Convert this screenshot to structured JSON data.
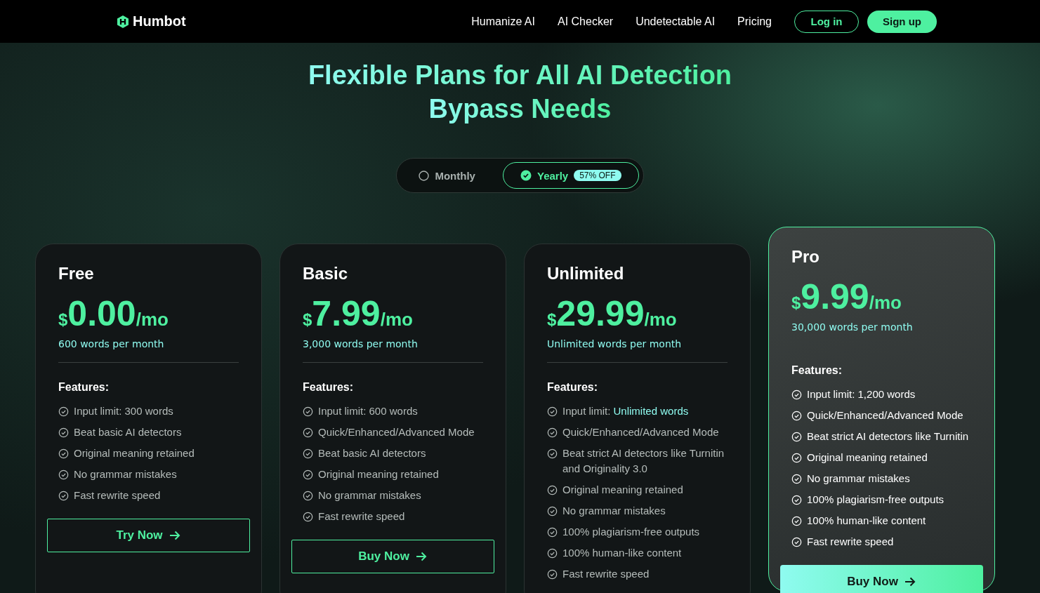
{
  "nav": {
    "brand": "Humbot",
    "links": [
      {
        "label": "Humanize AI"
      },
      {
        "label": "AI Checker"
      },
      {
        "label": "Undetectable AI"
      },
      {
        "label": "Pricing"
      }
    ],
    "login": "Log in",
    "signup": "Sign up"
  },
  "headline": [
    "Flexible Plans for All AI Detection",
    "Bypass Needs"
  ],
  "billing": [
    {
      "label": "Monthly",
      "selected": false
    },
    {
      "label": "Yearly",
      "selected": true,
      "badge": "57% OFF"
    }
  ],
  "plans": [
    {
      "name": "Free",
      "currency": "$",
      "price": "0.00",
      "period": "/mo",
      "words": "600 words per month",
      "featured": false,
      "features_title": "Features:",
      "features": [
        {
          "text": "Input limit: 300 words"
        },
        {
          "text": "Beat basic AI detectors"
        },
        {
          "text": "Original meaning retained"
        },
        {
          "text": "No grammar mistakes"
        },
        {
          "text": "Fast rewrite speed"
        }
      ],
      "button": "Try Now"
    },
    {
      "name": "Basic",
      "currency": "$",
      "price": "7.99",
      "period": "/mo",
      "words": "3,000 words per month",
      "featured": false,
      "features_title": "Features:",
      "features": [
        {
          "text": "Input limit: 600 words"
        },
        {
          "text": "Quick/Enhanced/Advanced Mode"
        },
        {
          "text": "Beat basic AI detectors"
        },
        {
          "text": "Original meaning retained"
        },
        {
          "text": "No grammar mistakes"
        },
        {
          "text": "Fast rewrite speed"
        }
      ],
      "button": "Buy Now"
    },
    {
      "name": "Unlimited",
      "currency": "$",
      "price": "29.99",
      "period": "/mo",
      "words": "Unlimited words per month",
      "featured": false,
      "features_title": "Features:",
      "features": [
        {
          "text": "Input limit: ",
          "highlight": "Unlimited words"
        },
        {
          "text": "Quick/Enhanced/Advanced Mode"
        },
        {
          "text": "Beat strict AI detectors like Turnitin and Originality 3.0"
        },
        {
          "text": "Original meaning retained"
        },
        {
          "text": "No grammar mistakes"
        },
        {
          "text": "100% plagiarism-free outputs"
        },
        {
          "text": "100% human-like content"
        },
        {
          "text": "Fast rewrite speed"
        }
      ]
    },
    {
      "name": "Pro",
      "currency": "$",
      "price": "9.99",
      "period": "/mo",
      "words": "30,000 words per month",
      "featured": true,
      "features_title": "Features:",
      "features": [
        {
          "text": "Input limit: 1,200 words"
        },
        {
          "text": "Quick/Enhanced/Advanced Mode"
        },
        {
          "text": "Beat strict AI detectors like Turnitin"
        },
        {
          "text": "Original meaning retained"
        },
        {
          "text": "No grammar mistakes"
        },
        {
          "text": "100% plagiarism-free outputs"
        },
        {
          "text": "100% human-like content"
        },
        {
          "text": "Fast rewrite speed"
        }
      ],
      "button": "Buy Now"
    }
  ]
}
